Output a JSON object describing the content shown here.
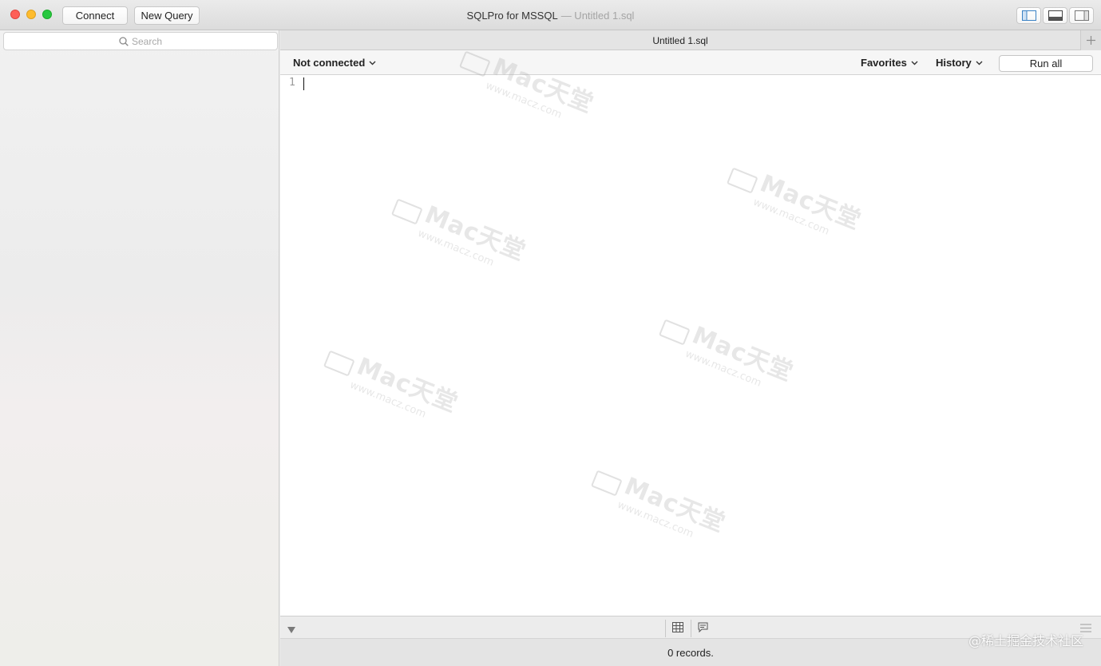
{
  "window": {
    "title": "SQLPro for MSSQL",
    "document": "— Untitled 1.sql"
  },
  "toolbar": {
    "connect_label": "Connect",
    "new_query_label": "New Query"
  },
  "sidebar": {
    "search": {
      "placeholder": "Search"
    }
  },
  "tabs": [
    {
      "label": "Untitled 1.sql",
      "active": true
    }
  ],
  "query_toolbar": {
    "connection_label": "Not connected",
    "favorites_label": "Favorites",
    "history_label": "History",
    "run_all_label": "Run all"
  },
  "editor": {
    "line_numbers": [
      "1"
    ],
    "content": ""
  },
  "status": {
    "records_label": "0 records."
  },
  "watermark": {
    "brand": "Mac天堂",
    "url": "www.macz.com"
  },
  "corner_tag": "@稀土掘金技术社区",
  "colors": {
    "close": "#fe5f57",
    "minimize": "#febc2e",
    "maximize": "#28c840",
    "layout_accent": "#3b82c4"
  }
}
